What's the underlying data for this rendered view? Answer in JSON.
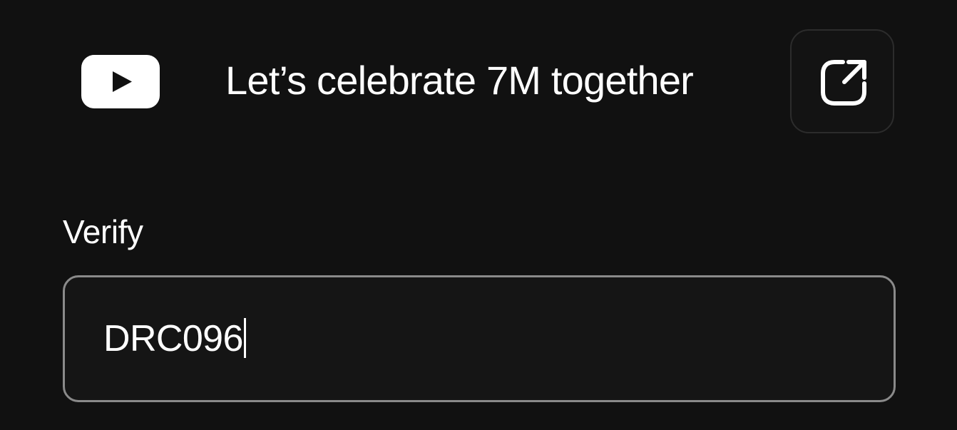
{
  "banner": {
    "logo_icon": "youtube-play-icon",
    "title": "Let’s celebrate 7M together",
    "share_icon": "share-external-icon"
  },
  "verify": {
    "label": "Verify",
    "value": "DRC096",
    "has_focus_caret": true
  },
  "colors": {
    "background": "#111111",
    "text": "#ffffff",
    "field_border": "#8a8a8a",
    "share_border": "#2c2c2c"
  }
}
